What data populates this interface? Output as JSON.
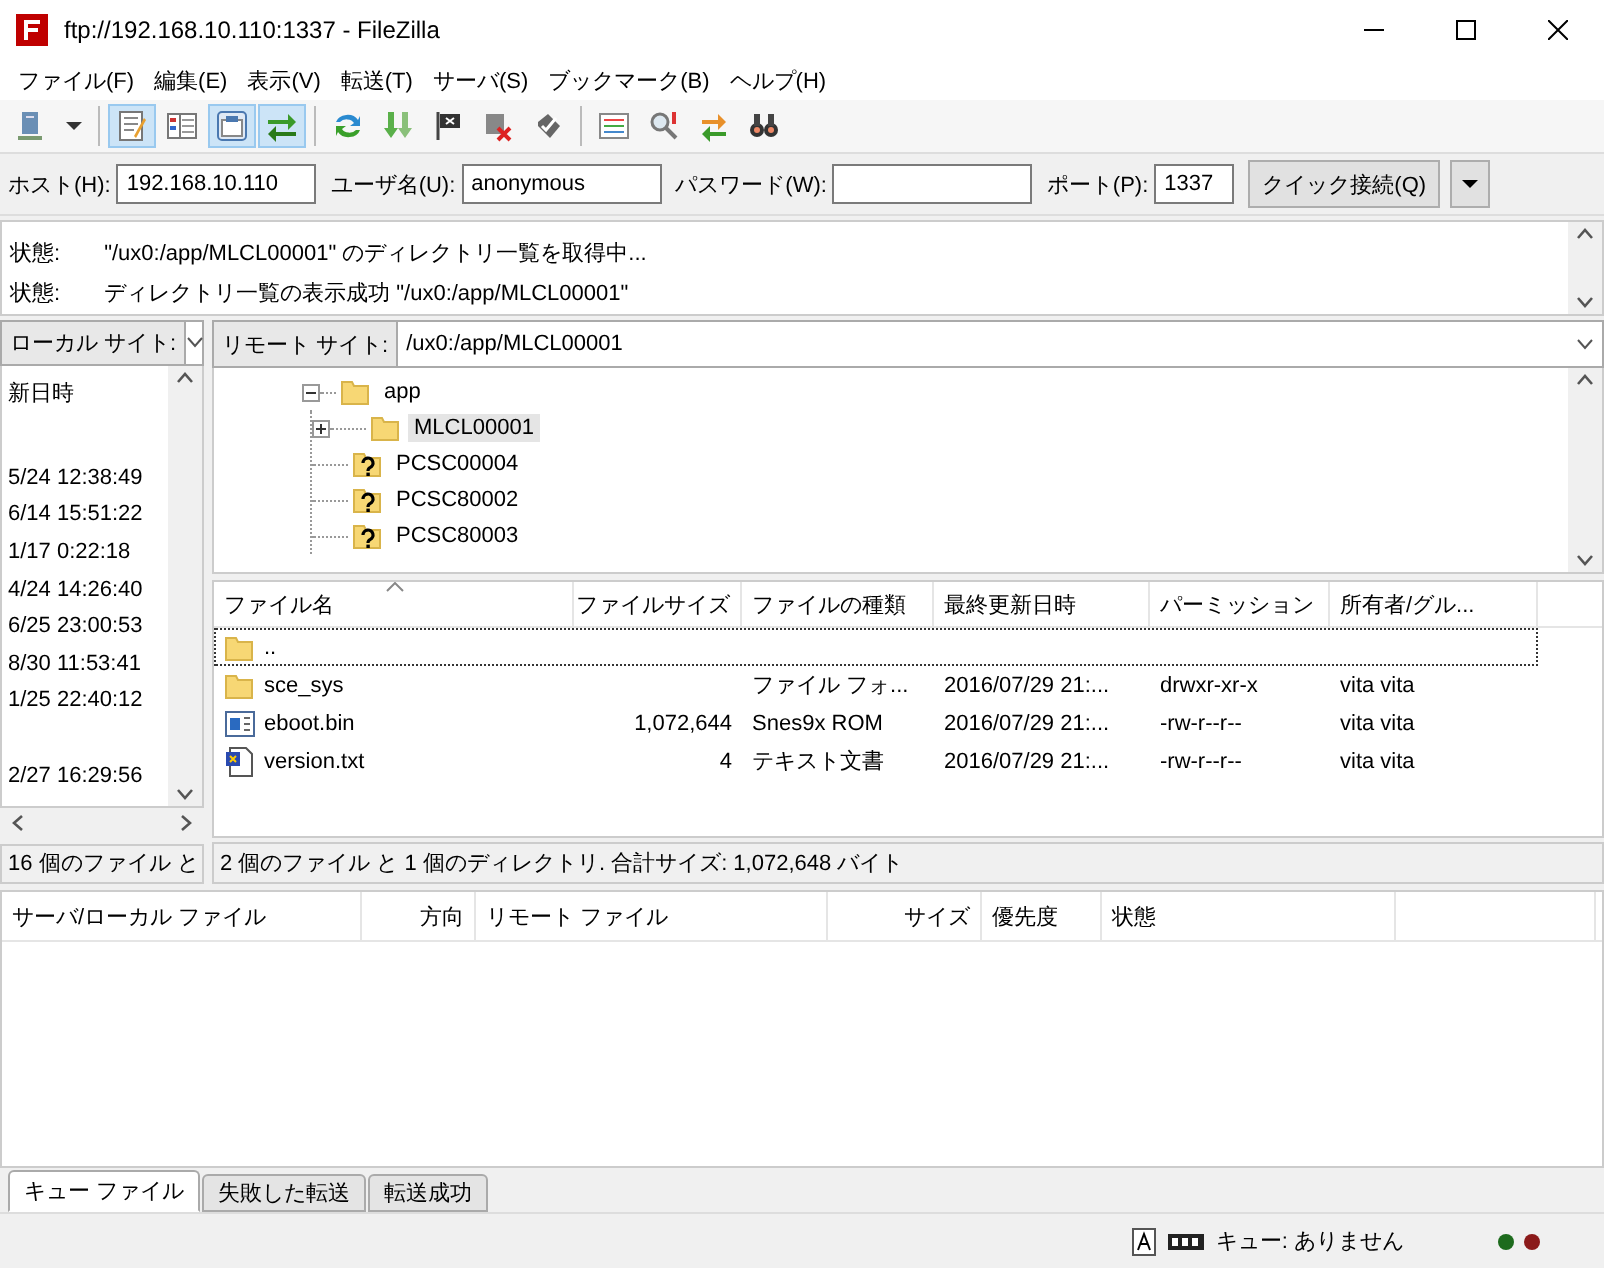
{
  "window": {
    "title": "ftp://192.168.10.110:1337 - FileZilla"
  },
  "menu": [
    "ファイル(F)",
    "編集(E)",
    "表示(V)",
    "転送(T)",
    "サーバ(S)",
    "ブックマーク(B)",
    "ヘルプ(H)"
  ],
  "toolbar": [
    {
      "kind": "server",
      "pressed": false
    },
    {
      "kind": "caret",
      "pressed": false
    },
    {
      "kind": "separator"
    },
    {
      "kind": "log",
      "pressed": true
    },
    {
      "kind": "localtree",
      "pressed": false
    },
    {
      "kind": "remotetree",
      "pressed": true
    },
    {
      "kind": "queue",
      "pressed": true
    },
    {
      "kind": "separator"
    },
    {
      "kind": "refresh",
      "pressed": false
    },
    {
      "kind": "process",
      "pressed": false
    },
    {
      "kind": "cancel",
      "pressed": false
    },
    {
      "kind": "disconnect",
      "pressed": false
    },
    {
      "kind": "reconnect",
      "pressed": false
    },
    {
      "kind": "separator"
    },
    {
      "kind": "filter",
      "pressed": false
    },
    {
      "kind": "compare",
      "pressed": false
    },
    {
      "kind": "sync",
      "pressed": false
    },
    {
      "kind": "search",
      "pressed": false
    }
  ],
  "quickconnect": {
    "fields": [
      {
        "label": "ホスト(H):",
        "value": "192.168.10.110",
        "kind": "text"
      },
      {
        "label": "ユーザ名(U):",
        "value": "anonymous",
        "kind": "text"
      },
      {
        "label": "パスワード(W):",
        "kind": "password"
      },
      {
        "label": "ポート(P):",
        "value": "1337",
        "kind": "port"
      }
    ],
    "button": "クイック接続(Q)"
  },
  "log": [
    {
      "label": "状態:",
      "message": "\"/ux0:/app/MLCL00001\" のディレクトリ一覧を取得中..."
    },
    {
      "label": "状態:",
      "message": "ディレクトリ一覧の表示成功 \"/ux0:/app/MLCL00001\""
    }
  ],
  "local": {
    "site_label": "ローカル サイト:",
    "column": "新日時",
    "rows": [
      {
        "kind": "dir"
      },
      {
        "kind": "file",
        "modified": "5/24 12:38:49"
      },
      {
        "kind": "file",
        "modified": "6/14 15:51:22"
      },
      {
        "kind": "file",
        "modified": "1/17 0:22:18"
      },
      {
        "kind": "file",
        "modified": "4/24 14:26:40"
      },
      {
        "kind": "file",
        "modified": "6/25 23:00:53"
      },
      {
        "kind": "file",
        "modified": "8/30 11:53:41"
      },
      {
        "kind": "file",
        "modified": "1/25 22:40:12"
      },
      {
        "kind": "dir"
      },
      {
        "kind": "file",
        "modified": "2/27 16:29:56"
      }
    ],
    "status": "16 個のファイル と"
  },
  "remote": {
    "site_label": "リモート サイト:",
    "path": "/ux0:/app/MLCL00001",
    "tree": [
      {
        "label": "app",
        "kind": "folder",
        "expanded": true,
        "selected": false,
        "children": [
          {
            "label": "MLCL00001",
            "kind": "folder",
            "expanded": false,
            "selected": true
          },
          {
            "label": "PCSC00004",
            "kind": "unknown",
            "selected": false
          },
          {
            "label": "PCSC80002",
            "kind": "unknown",
            "selected": false
          },
          {
            "label": "PCSC80003",
            "kind": "unknown",
            "selected": false
          }
        ]
      }
    ],
    "columns": [
      {
        "label": "ファイル名",
        "sorted": true
      },
      {
        "label": "ファイルサイズ",
        "sorted": false
      },
      {
        "label": "ファイルの種類",
        "sorted": false
      },
      {
        "label": "最終更新日時",
        "sorted": false
      },
      {
        "label": "パーミッション",
        "sorted": false
      },
      {
        "label": "所有者/グル...",
        "sorted": false
      }
    ],
    "files": [
      {
        "kind": "folder",
        "name": "..",
        "focused": true
      },
      {
        "kind": "folder",
        "name": "sce_sys",
        "type": "ファイル フォ...",
        "modified": "2016/07/29 21:...",
        "permissions": "drwxr-xr-x",
        "owner": "vita vita",
        "focused": false
      },
      {
        "kind": "binary",
        "name": "eboot.bin",
        "size": "1,072,644",
        "type": "Snes9x ROM",
        "modified": "2016/07/29 21:...",
        "permissions": "-rw-r--r--",
        "owner": "vita vita",
        "focused": false
      },
      {
        "kind": "text",
        "name": "version.txt",
        "size": "4",
        "type": "テキスト文書",
        "modified": "2016/07/29 21:...",
        "permissions": "-rw-r--r--",
        "owner": "vita vita",
        "focused": false
      }
    ],
    "status": "2 個のファイル と 1 個のディレクトリ. 合計サイズ: 1,072,648 バイト"
  },
  "queue": {
    "columns": [
      "サーバ/ローカル ファイル",
      "方向",
      "リモート ファイル",
      "サイズ",
      "優先度",
      "状態"
    ]
  },
  "tabs": [
    {
      "label": "キュー ファイル",
      "selected": true
    },
    {
      "label": "失敗した転送",
      "selected": false
    },
    {
      "label": "転送成功",
      "selected": false
    }
  ],
  "status_bar": {
    "queue": "キュー: ありません"
  }
}
